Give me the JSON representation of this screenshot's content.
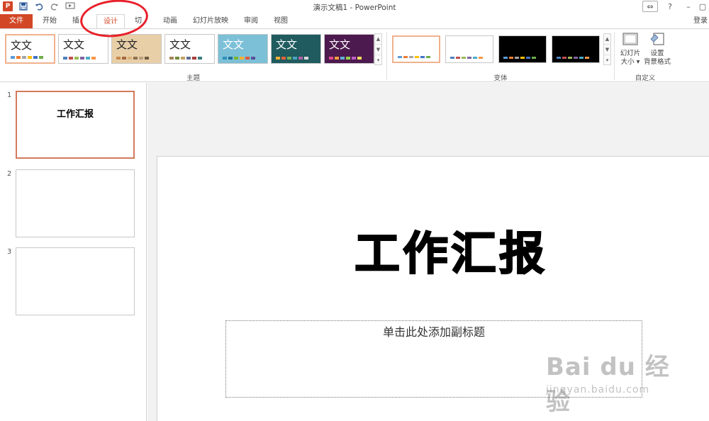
{
  "window": {
    "title": "演示文稿1 - PowerPoint",
    "app_logo": "P",
    "colors": {
      "accent": "#d24726",
      "annotation": "#e8202a"
    }
  },
  "qat": {
    "icons": [
      "powerpoint-logo-icon",
      "save-icon",
      "undo-icon",
      "redo-icon",
      "start-from-beginning-icon"
    ]
  },
  "tabs": {
    "file": "文件",
    "home": "开始",
    "insert": "插",
    "design": "设计",
    "transitions": "切",
    "animations": "动画",
    "slideshow": "幻灯片放映",
    "review": "审阅",
    "view": "视图",
    "login": "登录"
  },
  "ribbon": {
    "themes": {
      "label": "主题",
      "items": [
        {
          "text": "文文",
          "bg": "#ffffff",
          "swatches": [
            "#5b9bd5",
            "#ed7d31",
            "#a5a5a5",
            "#ffc000",
            "#4472c4",
            "#70ad47"
          ]
        },
        {
          "text": "文文",
          "bg": "#ffffff",
          "swatches": [
            "#4f81bd",
            "#c0504d",
            "#9bbb59",
            "#8064a2",
            "#4bacc6",
            "#f79646"
          ]
        },
        {
          "text": "文文",
          "bg": "#e8cfa8",
          "swatches": [
            "#c9894c",
            "#a5673f",
            "#d9b47b",
            "#8f6f4f",
            "#b8a07e",
            "#6f5b3e"
          ]
        },
        {
          "text": "文文",
          "bg": "#ffffff",
          "swatches": [
            "#a4825a",
            "#6f8b3c",
            "#c4a061",
            "#5e6e91",
            "#a2403a",
            "#3c7d82"
          ]
        },
        {
          "text": "文文",
          "bg": "#7cc0d8",
          "swatches": [
            "#2f8fba",
            "#1f6f96",
            "#7ab52e",
            "#f0b232",
            "#d85a40",
            "#5a4f99"
          ]
        },
        {
          "text": "文文",
          "bg": "#1f5b5f",
          "swatches": [
            "#f2b134",
            "#e85f3a",
            "#72b55a",
            "#4ba3c3",
            "#b55fa3",
            "#d9d9d9"
          ]
        },
        {
          "text": "文文",
          "bg": "#4d1a4f",
          "swatches": [
            "#e24a8e",
            "#f5a13c",
            "#5fb0d6",
            "#9bd14f",
            "#bf5dc8",
            "#f3e25c"
          ]
        }
      ]
    },
    "variants": {
      "label": "变体",
      "items": [
        {
          "dark": false,
          "swatches": [
            "#5b9bd5",
            "#ed7d31",
            "#a5a5a5",
            "#ffc000",
            "#4472c4",
            "#70ad47"
          ]
        },
        {
          "dark": false,
          "swatches": [
            "#4f81bd",
            "#c0504d",
            "#9bbb59",
            "#8064a2",
            "#4bacc6",
            "#f79646"
          ]
        },
        {
          "dark": true,
          "swatches": [
            "#5b9bd5",
            "#ed7d31",
            "#a5a5a5",
            "#ffc000",
            "#4472c4",
            "#70ad47"
          ]
        },
        {
          "dark": true,
          "swatches": [
            "#4f81bd",
            "#c0504d",
            "#9bbb59",
            "#8064a2",
            "#4bacc6",
            "#f79646"
          ]
        }
      ]
    },
    "customize": {
      "label": "自定义",
      "slide_size_line1": "幻灯片",
      "slide_size_line2": "大小 ▾",
      "format_bg_line1": "设置",
      "format_bg_line2": "背景格式"
    }
  },
  "thumbnails": {
    "items": [
      {
        "num": "1",
        "title": "工作汇报",
        "selected": true
      },
      {
        "num": "2",
        "title": "",
        "selected": false
      },
      {
        "num": "3",
        "title": "",
        "selected": false
      }
    ]
  },
  "slide": {
    "title": "工作汇报",
    "subtitle_placeholder": "单击此处添加副标题"
  },
  "watermark": {
    "logo": "Bai du 经验",
    "url": "jingyan.baidu.com"
  }
}
